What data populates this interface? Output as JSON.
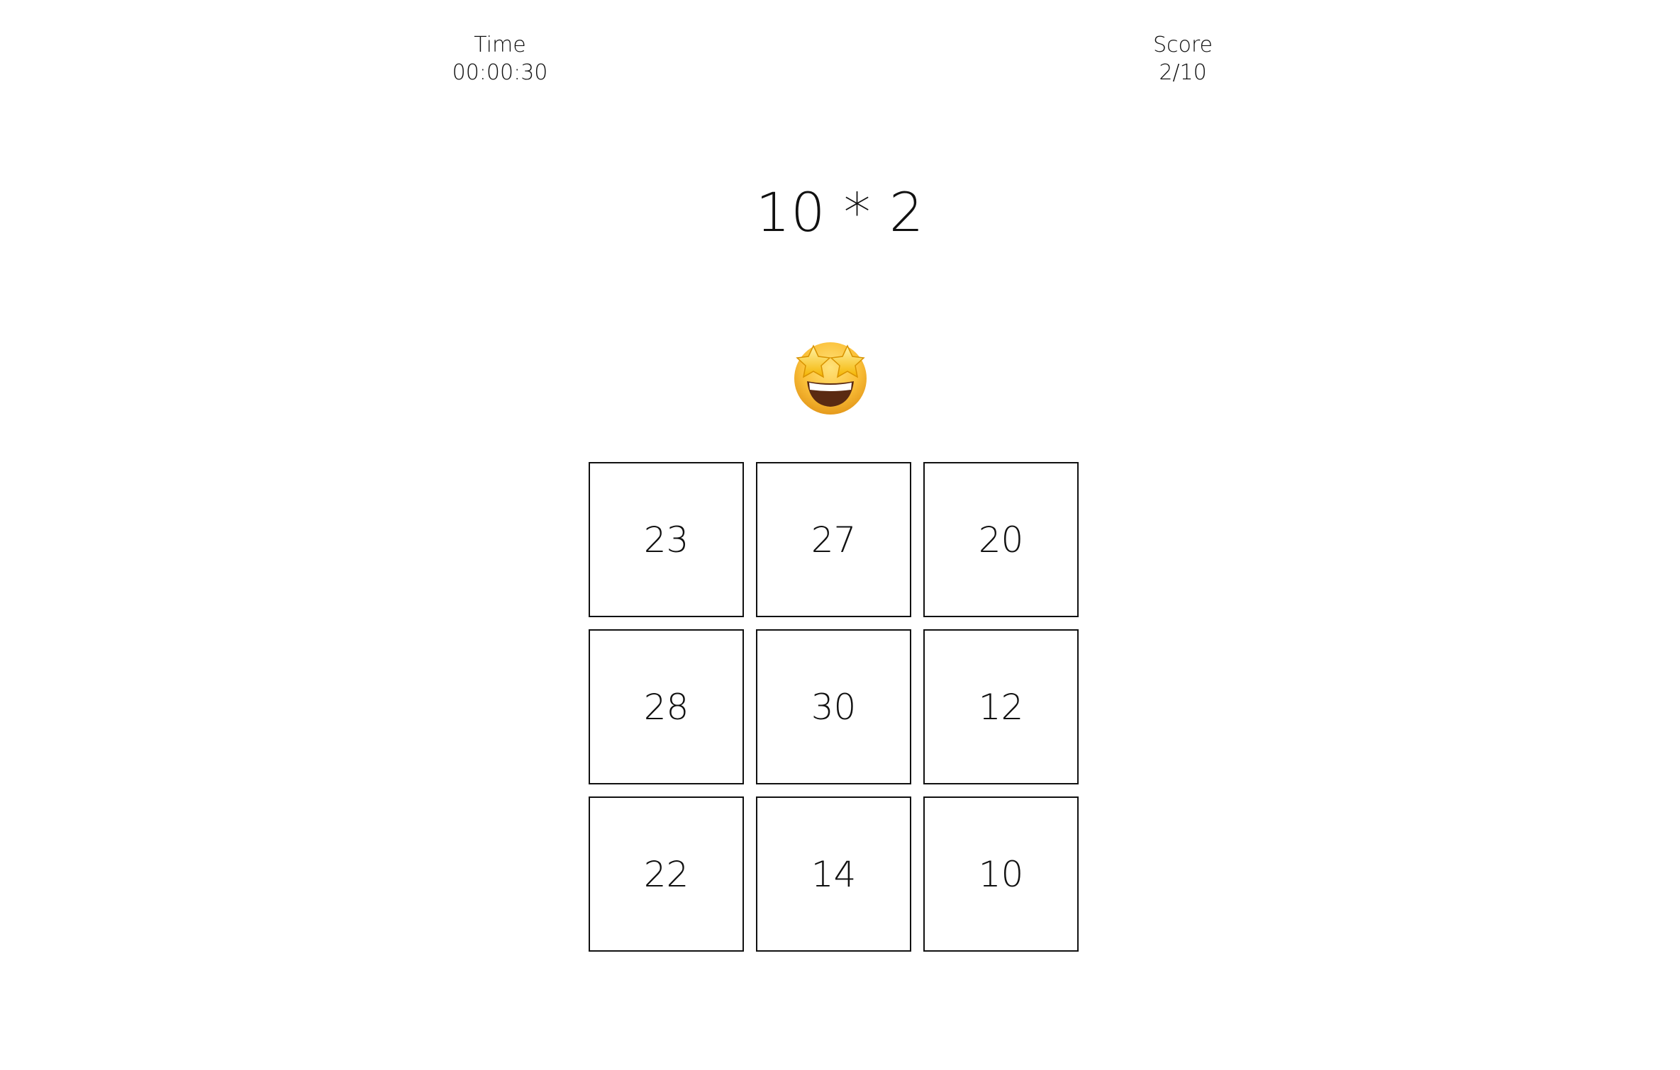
{
  "status": {
    "time_label": "Time",
    "time_value": "00:00:30",
    "score_label": "Score",
    "score_value": "2/10"
  },
  "question": {
    "text": "10 * 2"
  },
  "feedback": {
    "icon": "star-struck-emoji"
  },
  "answers": {
    "items": [
      {
        "value": "23"
      },
      {
        "value": "27"
      },
      {
        "value": "20"
      },
      {
        "value": "28"
      },
      {
        "value": "30"
      },
      {
        "value": "12"
      },
      {
        "value": "22"
      },
      {
        "value": "14"
      },
      {
        "value": "10"
      }
    ]
  },
  "colors": {
    "text": "#111111",
    "background": "#ffffff",
    "tile_border": "#111111",
    "emoji_face": "#f5b82b",
    "emoji_star": "#ffd23a"
  }
}
